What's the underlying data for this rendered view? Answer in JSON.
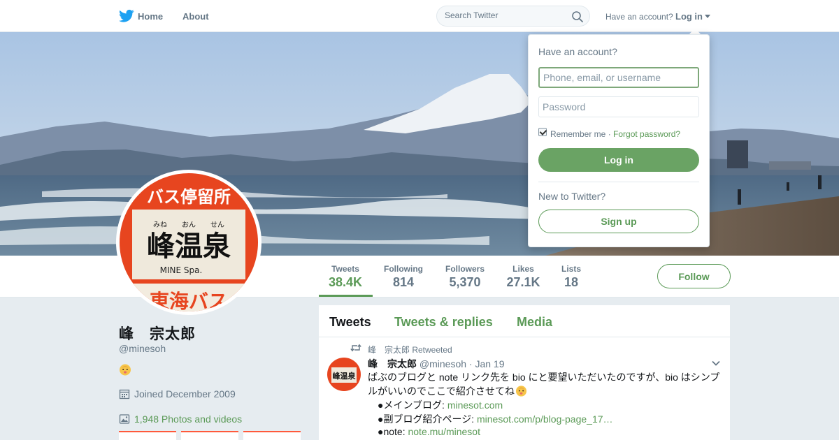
{
  "colors": {
    "accent": "#5b9a57",
    "text": "#14171a",
    "muted": "#657786",
    "brand": "#1da1f2"
  },
  "nav": {
    "home": "Home",
    "about": "About",
    "search_placeholder": "Search Twitter",
    "have_account": "Have an account?",
    "login": "Log in"
  },
  "profile": {
    "display_name": "峰　宗太郎",
    "handle": "@minesoh",
    "joined": "Joined December 2009",
    "photos": "1,948 Photos and videos",
    "avatar_sign": {
      "top": "バス停留所",
      "furigana": [
        "みね",
        "おん",
        "せん"
      ],
      "name": "峰温泉",
      "romaji": "MINE Spa.",
      "bottom": "東海バス"
    }
  },
  "stats": [
    {
      "label": "Tweets",
      "value": "38.4K"
    },
    {
      "label": "Following",
      "value": "814"
    },
    {
      "label": "Followers",
      "value": "5,370"
    },
    {
      "label": "Likes",
      "value": "27.1K"
    },
    {
      "label": "Lists",
      "value": "18"
    }
  ],
  "follow_button": "Follow",
  "tabs": [
    "Tweets",
    "Tweets & replies",
    "Media"
  ],
  "tweet": {
    "retweet_context": "峰　宗太郎 Retweeted",
    "name": "峰　宗太郎",
    "meta": "@minesoh · Jan 19",
    "text": "ばぶのブログと note リンク先を bio にと要望いただいたのですが、bio はシンプルがいいのでここで紹介させてね",
    "lines": [
      {
        "prefix": "●メインブログ: ",
        "link": "minesot.com"
      },
      {
        "prefix": "●副ブログ紹介ページ: ",
        "link": "minesot.com/p/blog-page_17…"
      },
      {
        "prefix": "●note: ",
        "link": "note.mu/minesot"
      }
    ]
  },
  "login_dropdown": {
    "title": "Have an account?",
    "username_placeholder": "Phone, email, or username",
    "password_placeholder": "Password",
    "remember": "Remember me",
    "separator": " · ",
    "forgot": "Forgot password?",
    "login_button": "Log in",
    "new_to": "New to Twitter?",
    "signup_button": "Sign up"
  }
}
